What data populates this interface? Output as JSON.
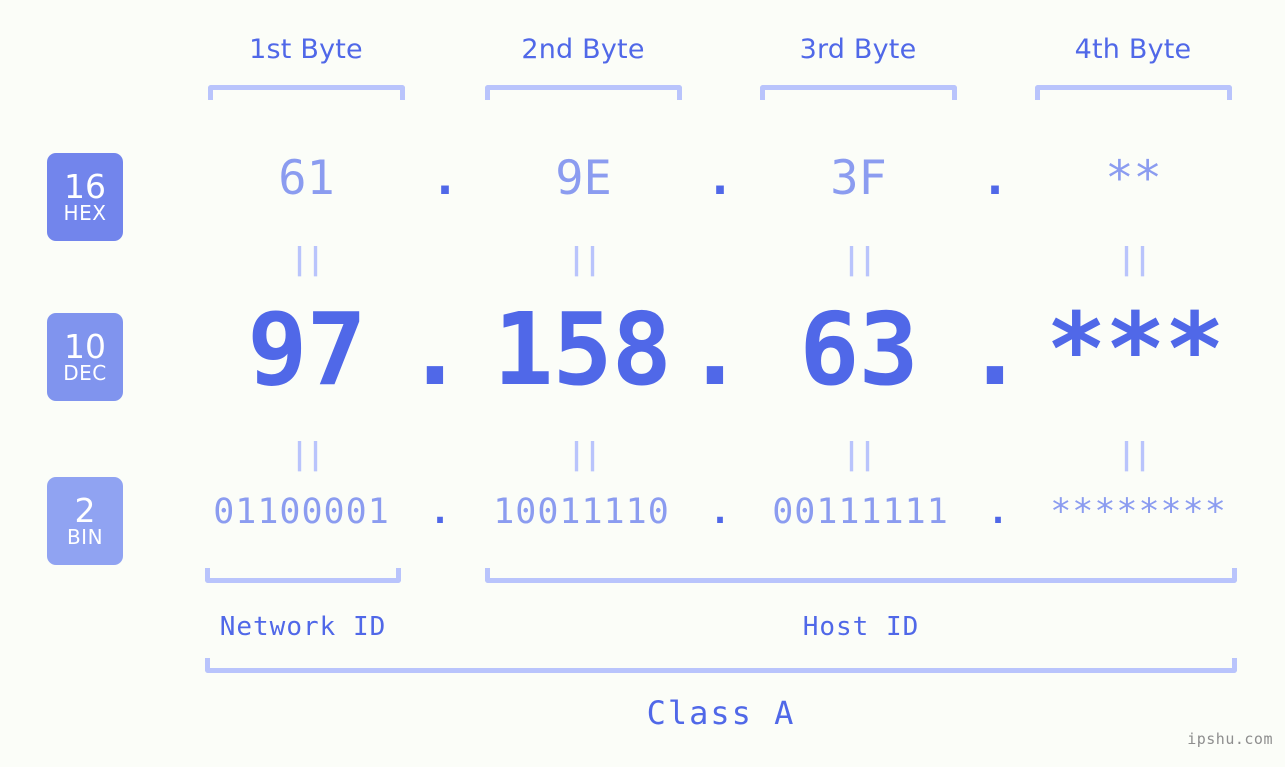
{
  "watermark": "ipshu.com",
  "byte_headers": [
    {
      "label": "1st Byte"
    },
    {
      "label": "2nd Byte"
    },
    {
      "label": "3rd Byte"
    },
    {
      "label": "4th Byte"
    }
  ],
  "bases": [
    {
      "number": "16",
      "name": "HEX",
      "color": "#7285ec"
    },
    {
      "number": "10",
      "name": "DEC",
      "color": "#8094ee"
    },
    {
      "number": "2",
      "name": "BIN",
      "color": "#90a3f2"
    }
  ],
  "rows": {
    "hex": {
      "base_number": "16",
      "base_name": "HEX",
      "values": [
        "61",
        "9E",
        "3F",
        "**"
      ],
      "separators": [
        ".",
        ".",
        "."
      ]
    },
    "dec": {
      "base_number": "10",
      "base_name": "DEC",
      "values": [
        "97",
        "158",
        "63",
        "***"
      ],
      "separators": [
        ".",
        ".",
        "."
      ]
    },
    "bin": {
      "base_number": "2",
      "base_name": "BIN",
      "values": [
        "01100001",
        "10011110",
        "00111111",
        "********"
      ],
      "separators": [
        ".",
        ".",
        "."
      ]
    }
  },
  "equals_marks": [
    "||",
    "||",
    "||",
    "||",
    "||",
    "||",
    "||",
    "||"
  ],
  "sections": {
    "network_id": "Network ID",
    "host_id": "Host ID",
    "class": "Class A"
  },
  "colors": {
    "background": "#fbfdf8",
    "primary": "#5068e8",
    "secondary": "#8b9cf0",
    "bracket": "#b9c4fc",
    "watermark": "#8e8e8e"
  }
}
